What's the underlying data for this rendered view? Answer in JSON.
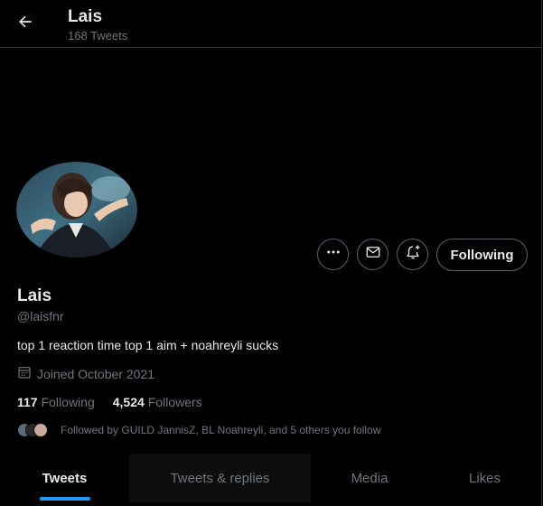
{
  "header": {
    "title": "Lais",
    "tweet_count": "168 Tweets",
    "back_icon": "arrow-left-icon"
  },
  "profile": {
    "display_name": "Lais",
    "handle": "@laisfnr",
    "bio": "top 1 reaction time top 1 aim + noahreyli sucks",
    "joined": "Joined October 2021",
    "following_count": "117",
    "following_label": "Following",
    "followers_count": "4,524",
    "followers_label": "Followers",
    "followed_by": "Followed by GUILD JannisZ, BL Noahreyli, and 5 others you follow"
  },
  "actions": {
    "more_icon": "more-horizontal-icon",
    "message_icon": "envelope-icon",
    "notify_icon": "bell-plus-icon",
    "following_button": "Following"
  },
  "tabs": [
    {
      "label": "Tweets",
      "active": true
    },
    {
      "label": "Tweets & replies",
      "active": false
    },
    {
      "label": "Media",
      "active": false
    },
    {
      "label": "Likes",
      "active": false
    }
  ],
  "colors": {
    "background": "#000000",
    "primary_text": "#e7e9ea",
    "secondary_text": "#71767b",
    "border": "#2f3336",
    "accent": "#1d9bf0"
  }
}
